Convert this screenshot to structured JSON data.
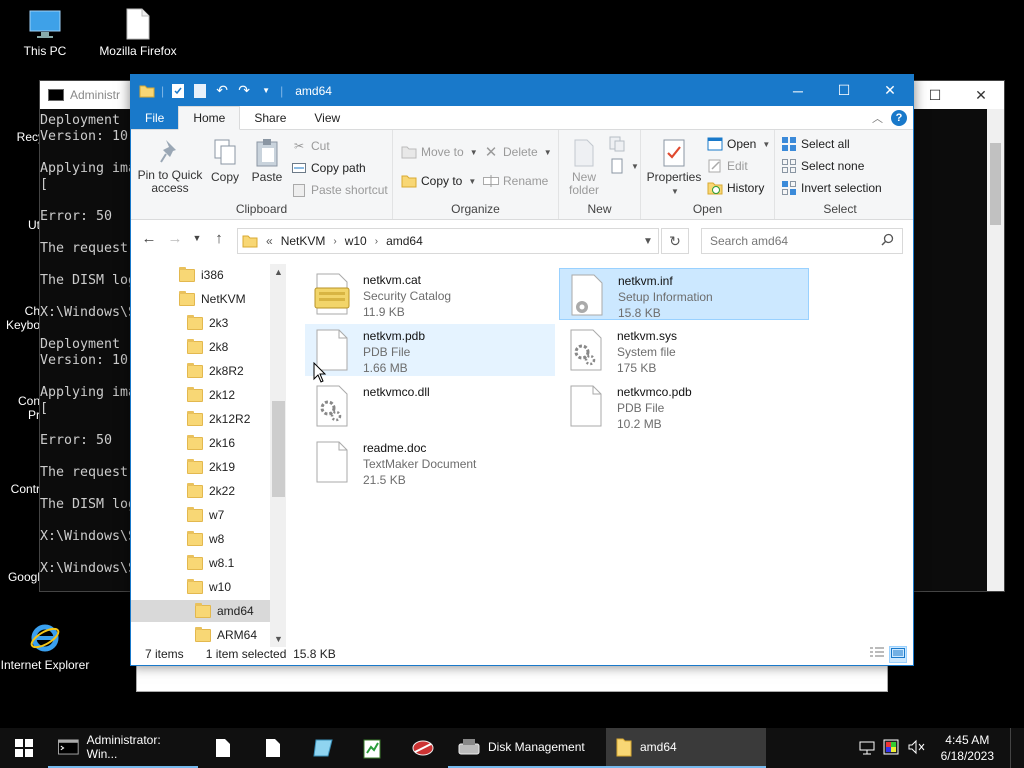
{
  "desktop": {
    "icons": [
      {
        "label": "This PC",
        "icon": "this-pc-icon"
      },
      {
        "label": "Mozilla Firefox",
        "icon": "file-icon"
      },
      {
        "label": "Recy",
        "icon": "recycle-bin-icon"
      },
      {
        "label": "Ut",
        "icon": "utility-icon"
      },
      {
        "label": "Ch",
        "icon": "app-icon"
      },
      {
        "label": "Keybo",
        "icon": "app-icon"
      },
      {
        "label": "Con",
        "icon": "app-icon"
      },
      {
        "label": "Pr",
        "icon": "app-icon"
      },
      {
        "label": "Contr",
        "icon": "control-panel-icon"
      },
      {
        "label": "Googl",
        "icon": "app-icon"
      },
      {
        "label": "Internet Explorer",
        "icon": "internet-explorer-icon"
      }
    ]
  },
  "console": {
    "title": "Administr",
    "lines": [
      "Deployment",
      "Version: 10",
      "",
      "Applying ima",
      "[",
      "",
      "Error: 50",
      "",
      "The request",
      "",
      "The DISM log",
      "",
      "X:\\Windows\\S",
      "",
      "Deployment",
      "Version: 10",
      "",
      "Applying ima",
      "[",
      "",
      "Error: 50",
      "",
      "The request",
      "",
      "The DISM log",
      "",
      "X:\\Windows\\S",
      "",
      "X:\\Windows\\S"
    ]
  },
  "explorer": {
    "title": "amd64",
    "tabs": {
      "file": "File",
      "home": "Home",
      "share": "Share",
      "view": "View"
    },
    "ribbon": {
      "clipboard": {
        "label": "Clipboard",
        "pin": "Pin to Quick",
        "pin2": "access",
        "copy": "Copy",
        "paste": "Paste",
        "cut": "Cut",
        "copy_path": "Copy path",
        "paste_shortcut": "Paste shortcut"
      },
      "organize": {
        "label": "Organize",
        "move_to": "Move to",
        "copy_to": "Copy to",
        "delete": "Delete",
        "rename": "Rename"
      },
      "new": {
        "label": "New",
        "new_folder": "New",
        "new_folder2": "folder"
      },
      "open": {
        "label": "Open",
        "properties": "Properties",
        "open": "Open",
        "edit": "Edit",
        "history": "History"
      },
      "select": {
        "label": "Select",
        "select_all": "Select all",
        "select_none": "Select none",
        "invert": "Invert selection"
      }
    },
    "address": {
      "overflow": "«",
      "crumbs": [
        "NetKVM",
        "w10",
        "amd64"
      ],
      "search_placeholder": "Search amd64"
    },
    "nav": [
      {
        "label": "i386",
        "indent": 0
      },
      {
        "label": "NetKVM",
        "indent": 0
      },
      {
        "label": "2k3",
        "indent": 1
      },
      {
        "label": "2k8",
        "indent": 1
      },
      {
        "label": "2k8R2",
        "indent": 1
      },
      {
        "label": "2k12",
        "indent": 1
      },
      {
        "label": "2k12R2",
        "indent": 1
      },
      {
        "label": "2k16",
        "indent": 1
      },
      {
        "label": "2k19",
        "indent": 1
      },
      {
        "label": "2k22",
        "indent": 1
      },
      {
        "label": "w7",
        "indent": 1
      },
      {
        "label": "w8",
        "indent": 1
      },
      {
        "label": "w8.1",
        "indent": 1
      },
      {
        "label": "w10",
        "indent": 1
      },
      {
        "label": "amd64",
        "indent": 2
      },
      {
        "label": "ARM64",
        "indent": 2
      }
    ],
    "files": [
      {
        "name": "netkvm.cat",
        "type": "Security Catalog",
        "size": "11.9 KB",
        "icon": "security-catalog-icon"
      },
      {
        "name": "netkvm.inf",
        "type": "Setup Information",
        "size": "15.8 KB",
        "icon": "setup-information-icon"
      },
      {
        "name": "netkvm.pdb",
        "type": "PDB File",
        "size": "1.66 MB",
        "icon": "document-icon"
      },
      {
        "name": "netkvm.sys",
        "type": "System file",
        "size": "175 KB",
        "icon": "system-file-icon"
      },
      {
        "name": "netkvmco.dll",
        "type": "",
        "size": "",
        "icon": "dll-file-icon"
      },
      {
        "name": "netkvmco.pdb",
        "type": "PDB File",
        "size": "10.2 MB",
        "icon": "document-icon"
      },
      {
        "name": "readme.doc",
        "type": "TextMaker Document",
        "size": "21.5 KB",
        "icon": "document-icon"
      }
    ],
    "status": {
      "count": "7 items",
      "selected": "1 item selected",
      "size": "15.8 KB"
    }
  },
  "taskbar": {
    "items": [
      {
        "label": "Administrator: Win...",
        "icon": "console-icon"
      },
      {
        "label": "Disk Management",
        "icon": "disk-management-icon"
      },
      {
        "label": "amd64",
        "icon": "folder-icon"
      }
    ],
    "clock": {
      "time": "4:45 AM",
      "date": "6/18/2023"
    }
  },
  "colors": {
    "accent": "#1979ca",
    "selection": "#cce8ff",
    "folder": "#f8d775"
  }
}
